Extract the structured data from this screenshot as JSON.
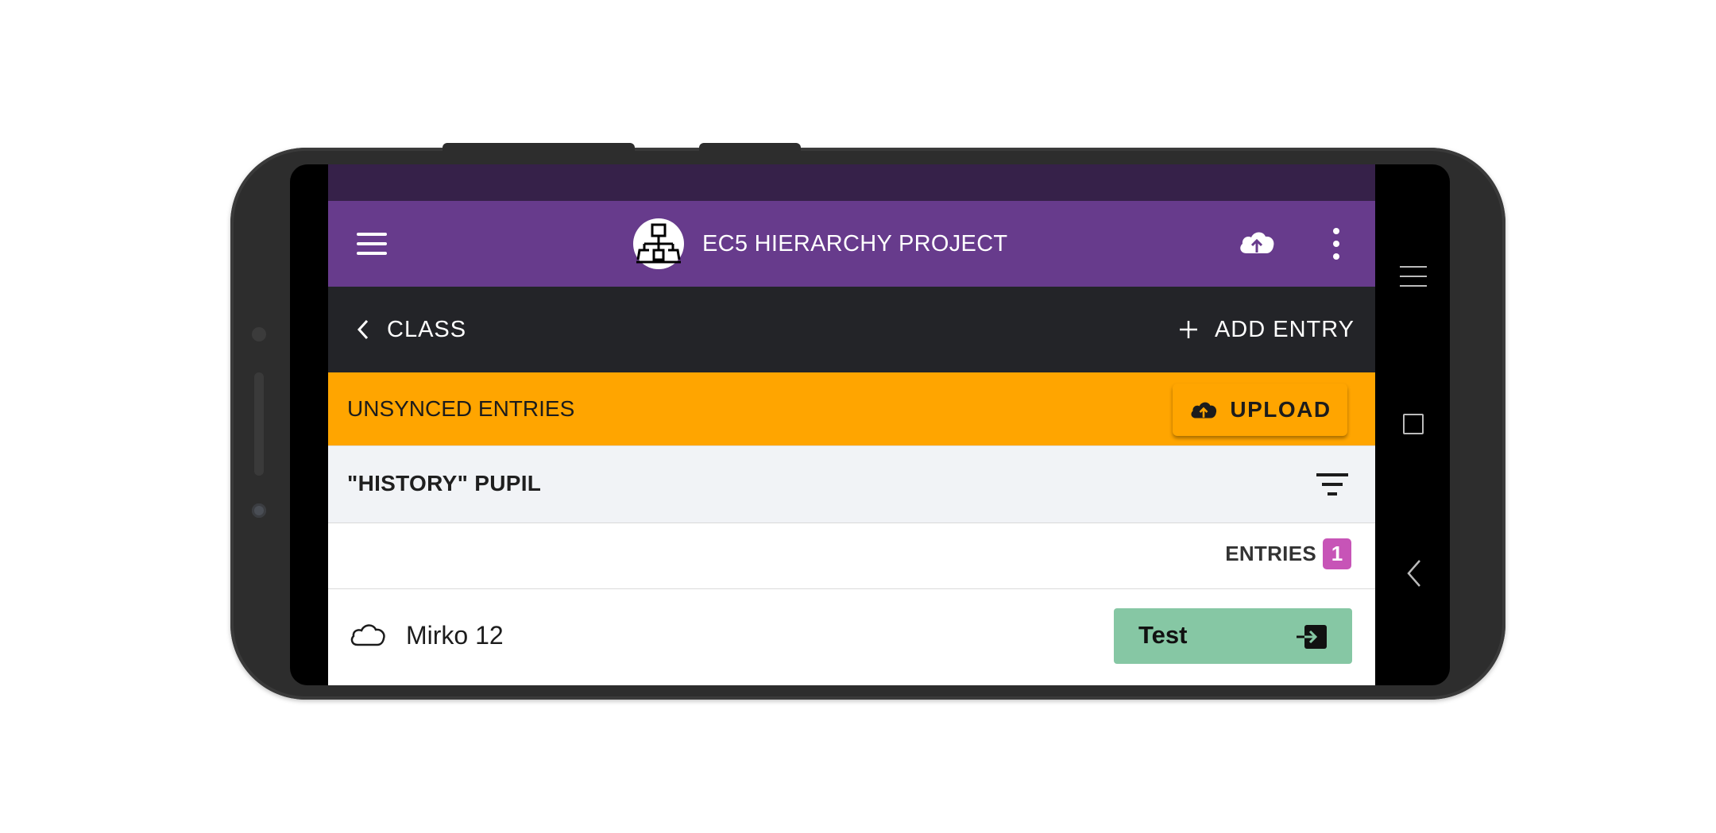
{
  "app_bar": {
    "title": "EC5 HIERARCHY PROJECT",
    "logo_icon": "hierarchy-diagram-icon",
    "upload_icon": "cloud-upload-icon",
    "menu_icon": "hamburger-menu-icon",
    "more_icon": "more-vertical-icon"
  },
  "nav_bar": {
    "back_label": "CLASS",
    "add_label": "ADD ENTRY"
  },
  "sync_bar": {
    "label": "UNSYNCED ENTRIES",
    "upload_label": "UPLOAD"
  },
  "filter_bar": {
    "title": "\"HISTORY\" PUPIL",
    "filter_icon": "filter-icon"
  },
  "entries": {
    "label": "ENTRIES",
    "count": "1",
    "items": [
      {
        "title": "Mirko 12",
        "status_icon": "cloud-outline-icon",
        "action_label": "Test"
      }
    ]
  },
  "colors": {
    "status_bar": "#362149",
    "app_bar": "#673b8c",
    "nav_bar": "#232428",
    "sync_bar": "#ffa500",
    "badge": "#c754b7",
    "goto_button": "#86c7a4"
  }
}
